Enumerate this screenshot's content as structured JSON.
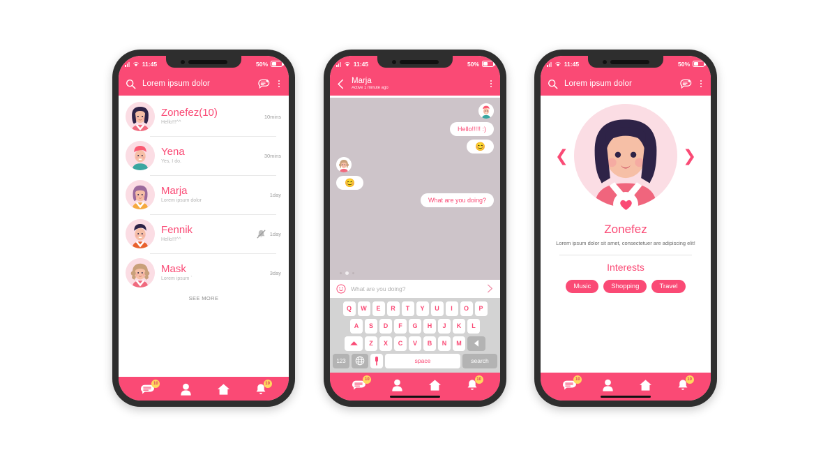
{
  "theme": {
    "pink": "#fa4a75",
    "pink_dark": "#e8376a",
    "badge_bg": "#ffd85e",
    "chat_bg": "#cdc4c9",
    "keyboard_bg": "#d3d3d3"
  },
  "status_bar": {
    "time": "11:45",
    "battery_percent": "50%",
    "signal_icon": "signal-bars-icon",
    "wifi_icon": "wifi-icon",
    "battery_icon": "battery-icon"
  },
  "phone1": {
    "header": {
      "title": "Lorem ipsum dolor",
      "search_icon": "search-icon",
      "new_message_icon": "new-message-icon",
      "menu_icon": "kebab-menu-icon"
    },
    "conversations": [
      {
        "name": "Zonefez(10)",
        "message": "Hello!!!^^",
        "time": "10mins",
        "muted": false,
        "avatar": "avatar-zonefez"
      },
      {
        "name": "Yena",
        "message": "Yes, I do.",
        "time": "30mins",
        "muted": false,
        "avatar": "avatar-yena"
      },
      {
        "name": "Marja",
        "message": "Lorem ipsum dolor",
        "time": "1day",
        "muted": false,
        "avatar": "avatar-marja"
      },
      {
        "name": "Fennik",
        "message": "Hello!!!^^",
        "time": "1day",
        "muted": true,
        "avatar": "avatar-fennik"
      },
      {
        "name": "Mask",
        "message": "Lorem ipsum `",
        "time": "3day",
        "muted": false,
        "avatar": "avatar-mask"
      }
    ],
    "see_more": "SEE MORE"
  },
  "phone2": {
    "header": {
      "back_icon": "back-arrow-icon",
      "name": "Marja",
      "status": "Active 1 minute ago",
      "menu_icon": "kebab-menu-icon"
    },
    "messages": [
      {
        "side": "right",
        "type": "avatar",
        "avatar": "avatar-yena"
      },
      {
        "side": "right",
        "type": "text",
        "text": "Hello!!!!! :)"
      },
      {
        "side": "right",
        "type": "emoji",
        "text": "😊"
      },
      {
        "side": "left",
        "type": "avatar",
        "avatar": "avatar-mask"
      },
      {
        "side": "left",
        "type": "emoji",
        "text": "😊"
      },
      {
        "side": "right",
        "type": "text",
        "text": "What are you doing?"
      }
    ],
    "pagination": {
      "count": 3,
      "active_index": 1
    },
    "input": {
      "placeholder": "What are you doing?",
      "emoji_icon": "smiley-icon",
      "send_icon": "send-chevron-icon"
    },
    "keyboard": {
      "row1": [
        "Q",
        "W",
        "E",
        "R",
        "T",
        "Y",
        "U",
        "I",
        "O",
        "P"
      ],
      "row2": [
        "A",
        "S",
        "D",
        "F",
        "G",
        "H",
        "J",
        "K",
        "L"
      ],
      "row3": [
        "Z",
        "X",
        "C",
        "V",
        "B",
        "N",
        "M"
      ],
      "shift_icon": "shift-up-icon",
      "backspace_icon": "backspace-icon",
      "numbers_label": "123",
      "globe_icon": "globe-icon",
      "mic_icon": "microphone-icon",
      "space_label": "space",
      "search_label": "search"
    }
  },
  "phone3": {
    "header": {
      "title": "Lorem ipsum dolor",
      "search_icon": "search-icon",
      "new_message_icon": "new-message-icon",
      "menu_icon": "kebab-menu-icon"
    },
    "prev_icon": "chevron-left-icon",
    "next_icon": "chevron-right-icon",
    "avatar": "avatar-zonefez",
    "heart_icon": "heart-icon",
    "name": "Zonefez",
    "bio": "Lorem ipsum dolor sit amet, consectetuer are adipiscing elit!",
    "interests_title": "Interests",
    "tags": [
      "Music",
      "Shopping",
      "Travel"
    ]
  },
  "bottom_nav": {
    "items": [
      {
        "icon": "chat-bubble-icon",
        "badge": "10"
      },
      {
        "icon": "person-icon",
        "badge": ""
      },
      {
        "icon": "home-icon",
        "badge": ""
      },
      {
        "icon": "bell-icon",
        "badge": "10"
      }
    ]
  }
}
